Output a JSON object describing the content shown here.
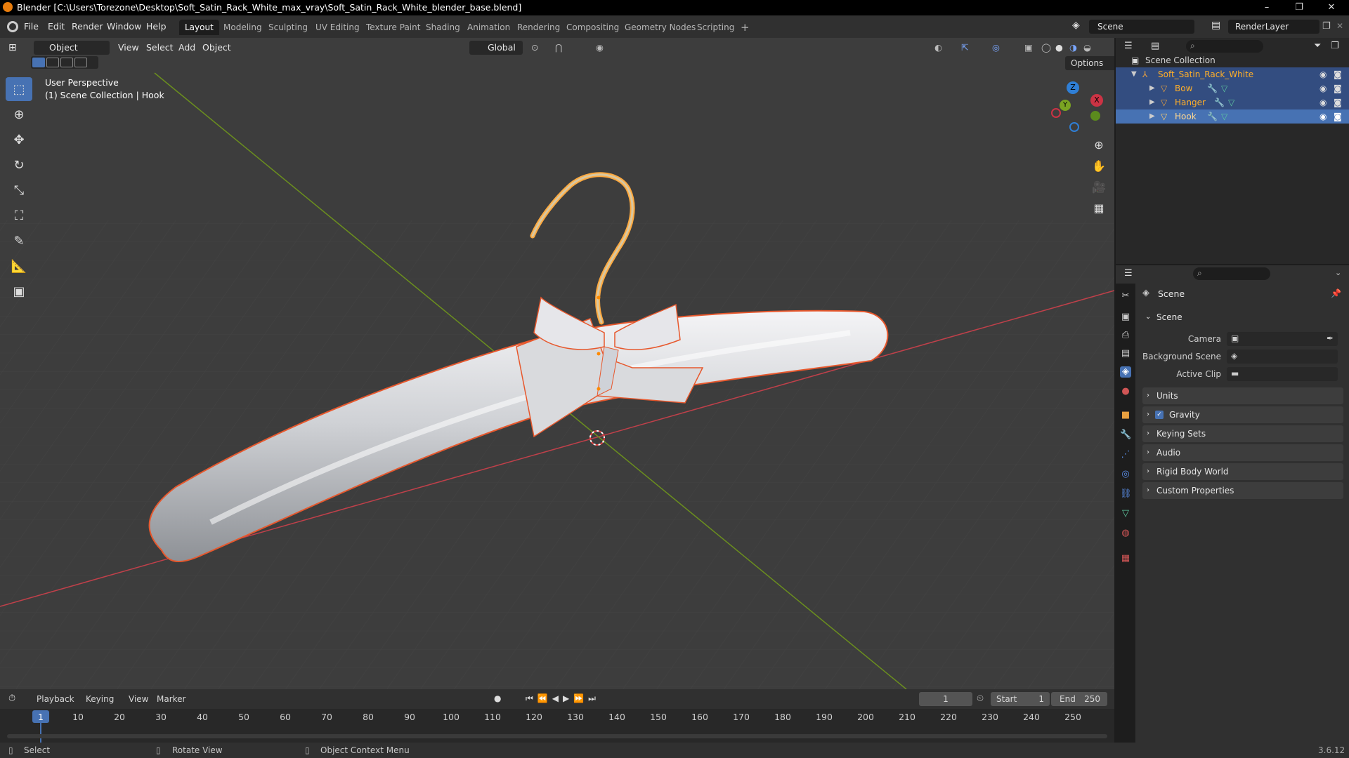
{
  "window": {
    "title": "Blender [C:\\Users\\Torezone\\Desktop\\Soft_Satin_Rack_White_max_vray\\Soft_Satin_Rack_White_blender_base.blend]",
    "minimize": "–",
    "maximize": "❐",
    "close": "✕"
  },
  "menu": [
    "File",
    "Edit",
    "Render",
    "Window",
    "Help"
  ],
  "workspaces": [
    "Layout",
    "Modeling",
    "Sculpting",
    "UV Editing",
    "Texture Paint",
    "Shading",
    "Animation",
    "Rendering",
    "Compositing",
    "Geometry Nodes",
    "Scripting"
  ],
  "workspace_add": "+",
  "scene_name": "Scene",
  "view_layer": "RenderLayer",
  "viewport": {
    "mode": "Object Mode",
    "menus": [
      "View",
      "Select",
      "Add",
      "Object"
    ],
    "orientation": "Global",
    "options": "Options",
    "perspective": "User Perspective",
    "collection_info": "(1) Scene Collection | Hook",
    "gizmo": {
      "x": "X",
      "y": "Y",
      "z": "Z"
    }
  },
  "outliner": {
    "root": "Scene Collection",
    "items": [
      {
        "name": "Soft_Satin_Rack_White"
      },
      {
        "name": "Bow"
      },
      {
        "name": "Hanger"
      },
      {
        "name": "Hook"
      }
    ]
  },
  "properties": {
    "header": "Scene",
    "section": "Scene",
    "camera_label": "Camera",
    "background_label": "Background Scene",
    "clip_label": "Active Clip",
    "panels": [
      "Units",
      "Gravity",
      "Keying Sets",
      "Audio",
      "Rigid Body World",
      "Custom Properties"
    ]
  },
  "timeline": {
    "menus": [
      "Playback",
      "Keying",
      "View",
      "Marker"
    ],
    "current_frame": "1",
    "start_label": "Start",
    "start": "1",
    "end_label": "End",
    "end": "250",
    "ticks": [
      "1",
      "10",
      "20",
      "30",
      "40",
      "50",
      "60",
      "70",
      "80",
      "90",
      "100",
      "110",
      "120",
      "130",
      "140",
      "150",
      "160",
      "170",
      "180",
      "190",
      "200",
      "210",
      "220",
      "230",
      "240",
      "250"
    ]
  },
  "status": {
    "select": "Select",
    "rotate": "Rotate View",
    "context": "Object Context Menu",
    "version": "3.6.12"
  },
  "colors": {
    "accent": "#4772b3",
    "selection_outline": "#e7582d",
    "active_outline": "#ffaa40",
    "x_axis": "#cc3344",
    "y_axis": "#7aa322",
    "z_axis": "#2f7fd6"
  }
}
